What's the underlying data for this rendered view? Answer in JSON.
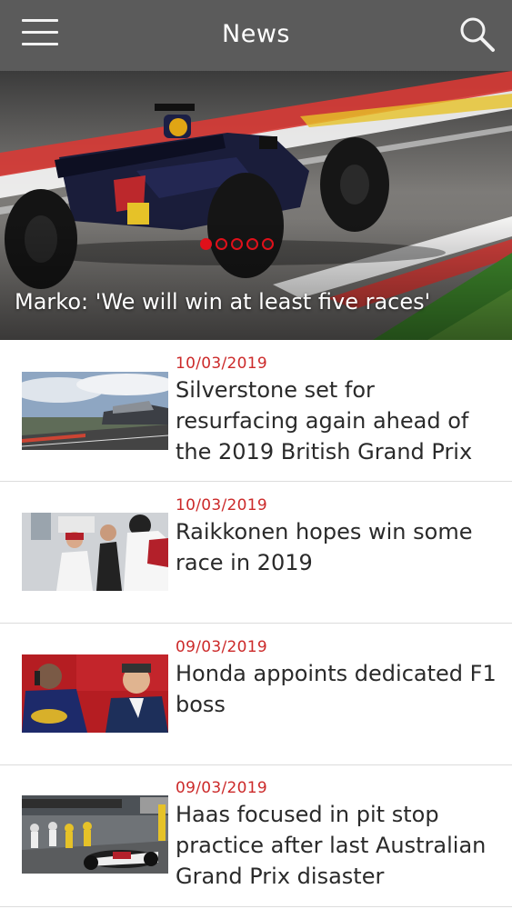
{
  "header": {
    "title": "News",
    "menu_icon": "hamburger-icon",
    "search_icon": "search-icon",
    "background": "#5b5b5b"
  },
  "hero": {
    "caption": "Marko: 'We will win at least five races'",
    "slides_total": 5,
    "active_slide": 1,
    "accent": "#e0101a"
  },
  "news": [
    {
      "date": "10/03/2019",
      "title": "Silverstone set for resurfacing again ahead of the 2019 British Grand Prix"
    },
    {
      "date": "10/03/2019",
      "title": "Raikkonen hopes win some race in 2019"
    },
    {
      "date": "09/03/2019",
      "title": "Honda appoints dedicated F1 boss"
    },
    {
      "date": "09/03/2019",
      "title": "Haas focused in pit stop practice after last Australian Grand Prix disaster"
    }
  ],
  "colors": {
    "date": "#cc2a2a",
    "title": "#2a2a2a",
    "divider": "#dcdcdc"
  }
}
